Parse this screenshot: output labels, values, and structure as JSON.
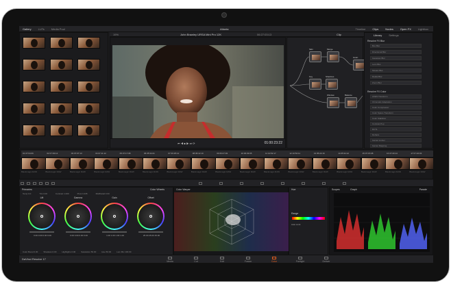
{
  "app": {
    "project_title": "Atlanta",
    "app_name": "DaVinci Resolve 17"
  },
  "top_tabs": {
    "gallery": "Gallery",
    "luts": "LUTs",
    "media_pool": "Media Pool"
  },
  "top_right_tabs": {
    "timeline": "Timeline",
    "clips": "Clips",
    "nodes": "Nodes",
    "open_fx": "Open FX",
    "lightbox": "Lightbox"
  },
  "viewer": {
    "zoom": "19%",
    "clip_title": "John Brawley URSA Mini Pro 12K",
    "source_tc": "06:27:03:13",
    "timecode": "01:00:23:22",
    "clip_label": "Clip"
  },
  "library": {
    "tabs": [
      "Library",
      "Settings"
    ],
    "blur_header": "Resolve FX Blur",
    "blur_items": [
      "Box Blur",
      "Directional Blur",
      "Gaussian Blur",
      "Lens Blur",
      "Mosaic Blur",
      "Radial Blur",
      "Zoom Blur"
    ],
    "color_header": "Resolve FX Color",
    "color_items": [
      "ACES Transform",
      "Chromatic Adaptation",
      "Color Compressor",
      "Color Space Transform",
      "Color Stabilizer",
      "Contrast Pop",
      "DCTL",
      "Dehaze",
      "Gamut Limiter",
      "Gamut Mapping"
    ]
  },
  "nodes": [
    {
      "num": "01",
      "label": "Skin"
    },
    {
      "num": "02",
      "label": "Merge"
    },
    {
      "num": "03",
      "label": "Key"
    },
    {
      "num": "04",
      "label": "Shadows"
    },
    {
      "num": "05",
      "label": "Window"
    },
    {
      "num": "06",
      "label": "Balance"
    },
    {
      "num": "07",
      "label": "Grain"
    }
  ],
  "timeline_clips": [
    {
      "num": "01 07:04:06",
      "name": "Blackmagic RAW"
    },
    {
      "num": "02 07:03:12",
      "name": "Blackmagic RAW"
    },
    {
      "num": "03 07:07:13",
      "name": "Blackmagic RAW"
    },
    {
      "num": "04 07:11:12",
      "name": "Blackmagic RAW"
    },
    {
      "num": "05 07:17:08",
      "name": "Blackmagic RAW"
    },
    {
      "num": "06 05:34:21",
      "name": "Blackmagic RAW"
    },
    {
      "num": "07 06:25:12",
      "name": "Blackmagic RAW"
    },
    {
      "num": "08 06:12:10",
      "name": "Blackmagic RAW"
    },
    {
      "num": "09 06:27:03",
      "name": "Blackmagic RAW"
    },
    {
      "num": "10 06:49:05",
      "name": "Blackmagic RAW"
    },
    {
      "num": "11 10:52:17",
      "name": "Blackmagic RAW"
    },
    {
      "num": "12 10:54:11",
      "name": "Blackmagic RAW"
    },
    {
      "num": "13 05:22:16",
      "name": "Blackmagic RAW"
    },
    {
      "num": "14 05:34:12",
      "name": "Blackmagic RAW"
    },
    {
      "num": "15 07:15:08",
      "name": "Blackmagic RAW"
    },
    {
      "num": "16 07:20:14",
      "name": "Blackmagic RAW"
    },
    {
      "num": "17 07:24:03",
      "name": "Blackmagic RAW"
    }
  ],
  "palette": {
    "primaries": "Primaries",
    "color_wheels": "Color Wheels",
    "color_warper": "Color Warper",
    "scopes": "Scopes",
    "graph": "Graph",
    "parade": "Parade",
    "temp": "Temp 0.0",
    "tint": "Tint 0.00",
    "contrast": "Contrast 1.000",
    "pivot": "Pivot 0.435",
    "md": "Mid/Detail 0.00",
    "wheels": [
      {
        "title": "Lift",
        "vals": "0.00  0.00  0.00  0.00"
      },
      {
        "title": "Gamma",
        "vals": "0.00  0.00  0.00  0.00"
      },
      {
        "title": "Gain",
        "vals": "1.00  1.00  1.00  1.00"
      },
      {
        "title": "Offset",
        "vals": "25.00  25.00  25.00"
      }
    ],
    "footer": {
      "color_boost": "Color Boost 0.00",
      "shadows": "Shadows 0.00",
      "highlights": "Highlights 0.00",
      "saturation": "Saturation 50.00",
      "hue": "Hue 50.00",
      "lum_mix": "Lum Mix 100.00"
    },
    "range": "Range",
    "hue_label": "Hue",
    "auto_label": "Auto Limit"
  },
  "pages": [
    "Media",
    "Cut",
    "Edit",
    "Fusion",
    "Color",
    "Fairlight",
    "Deliver"
  ],
  "accent": "#e25c1f"
}
